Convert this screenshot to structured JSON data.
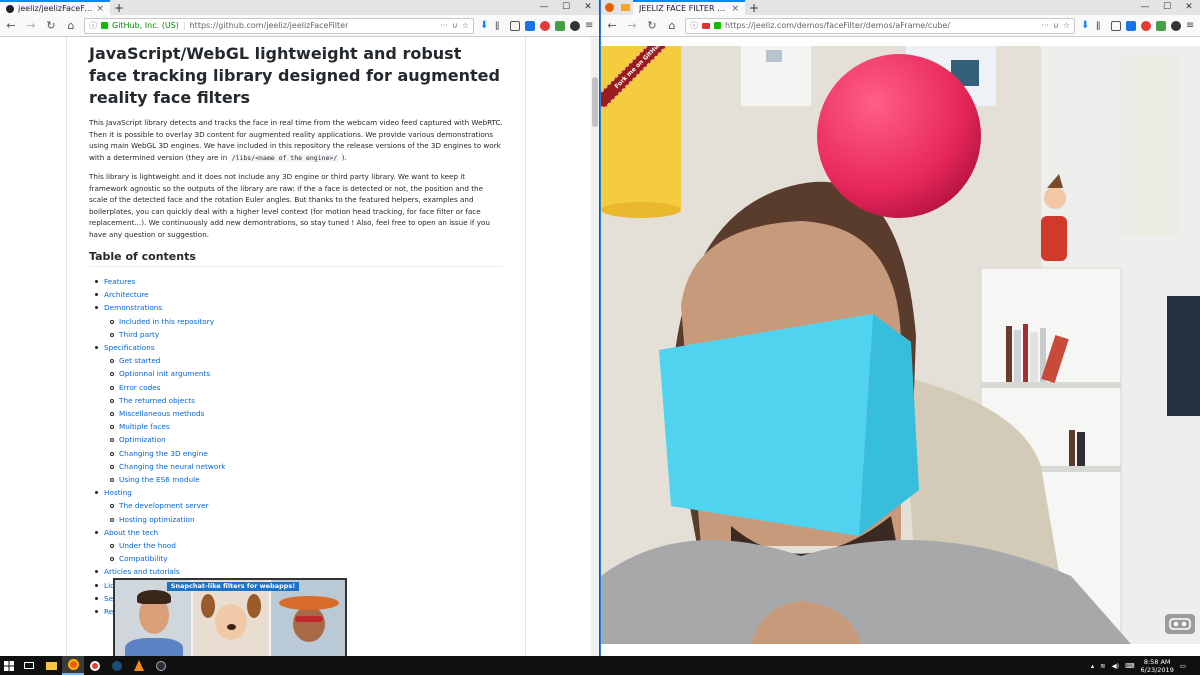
{
  "left_window": {
    "tab_title": "jeeliz/jeelizFaceFilter: Javascript/WebGL",
    "close_label": "×",
    "newtab_label": "+",
    "identity": "GitHub, Inc. (US)",
    "url": "https://github.com/jeeliz/jeelizFaceFilter",
    "heading": "JavaScript/WebGL lightweight and robust face tracking library designed for augmented reality face filters",
    "para1_a": "This JavaScript library detects and tracks the face in real time from the webcam video feed captured with WebRTC. Then it is possible to overlay 3D content for augmented reality applications. We provide various demonstrations using main WebGL 3D engines. We have included in this repository the release versions of the 3D engines to work with a determined version (they are in",
    "para1_code": "/libs/<name of the engine>/",
    "para1_b": ").",
    "para2": "This library is lightweight and it does not include any 3D engine or third party library. We want to keep it framework agnostic so the outputs of the library are raw: if the a face is detected or not, the position and the scale of the detected face and the rotation Euler angles. But thanks to the featured helpers, examples and boilerplates, you can quickly deal with a higher level context (for motion head tracking, for face filter or face replacement...). We continuously add new demontrations, so stay tuned ! Also, feel free to open an issue if you have any question or suggestion.",
    "toc_heading": "Table of contents",
    "toc": [
      {
        "label": "Features",
        "level": 1
      },
      {
        "label": "Architecture",
        "level": 1
      },
      {
        "label": "Demonstrations",
        "level": 1
      },
      {
        "label": "Included in this repository",
        "level": 2
      },
      {
        "label": "Third party",
        "level": 2
      },
      {
        "label": "Specifications",
        "level": 1
      },
      {
        "label": "Get started",
        "level": 2
      },
      {
        "label": "Optionnal init arguments",
        "level": 2
      },
      {
        "label": "Error codes",
        "level": 2
      },
      {
        "label": "The returned objects",
        "level": 2
      },
      {
        "label": "Miscellaneous methods",
        "level": 2
      },
      {
        "label": "Multiple faces",
        "level": 2
      },
      {
        "label": "Optimization",
        "level": 2
      },
      {
        "label": "Changing the 3D engine",
        "level": 2
      },
      {
        "label": "Changing the neural network",
        "level": 2
      },
      {
        "label": "Using the ES6 module",
        "level": 2
      },
      {
        "label": "Hosting",
        "level": 1
      },
      {
        "label": "The development server",
        "level": 2
      },
      {
        "label": "Hosting optimization",
        "level": 2
      },
      {
        "label": "About the tech",
        "level": 1
      },
      {
        "label": "Under the hood",
        "level": 2
      },
      {
        "label": "Compatibility",
        "level": 2
      },
      {
        "label": "Articles and tutorials",
        "level": 1
      },
      {
        "label": "License",
        "level": 1
      },
      {
        "label": "See also",
        "level": 1
      },
      {
        "label": "References",
        "level": 1
      }
    ],
    "banner_text": "Snapchat-like filters for webapps!"
  },
  "right_window": {
    "tab_title": "JEELIZ FACE FILTER : A-FRAME CUBE",
    "close_label": "×",
    "newtab_label": "+",
    "url": "https://jeeliz.com/demos/faceFilter/demos/aFrame/cube/",
    "ribbon_text": "Fork me on GitHub"
  },
  "taskbar": {
    "time": "8:58 AM",
    "date": "6/23/2019",
    "apps": [
      "start",
      "task-view",
      "file-explorer",
      "firefox",
      "chrome",
      "steam",
      "vlc",
      "obs"
    ]
  },
  "colors": {
    "link": "#0366d6",
    "sphere": "#e8285a",
    "cube": "#4fd3ef",
    "cylinder": "#f5cc3e",
    "taskbar": "#101010"
  }
}
